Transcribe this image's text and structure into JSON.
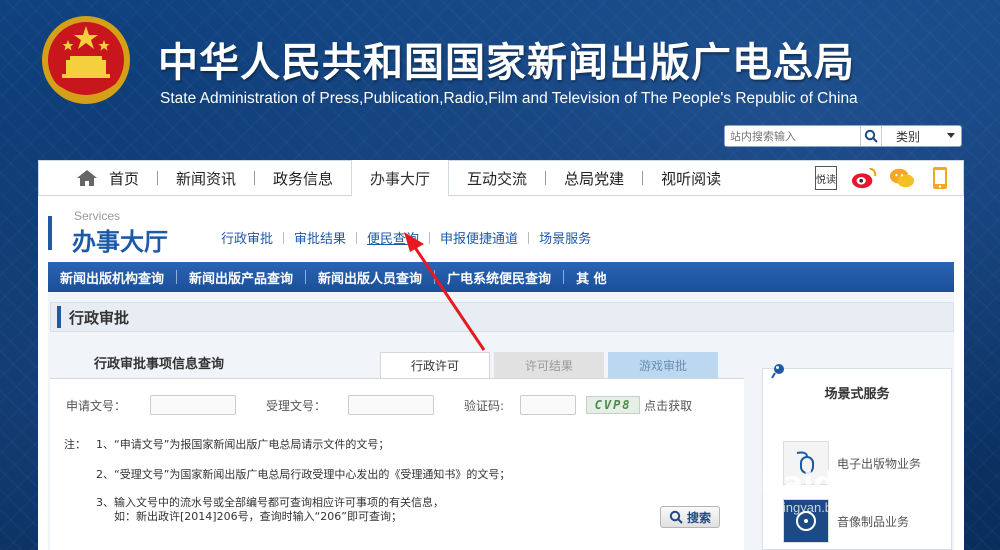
{
  "header": {
    "title": "中华人民共和国国家新闻出版广电总局",
    "subtitle": "State Administration of Press,Publication,Radio,Film and Television of The People's Republic of China",
    "search_placeholder": "站内搜索输入",
    "search_category": "类别"
  },
  "topnav": {
    "items": [
      "首页",
      "新闻资讯",
      "政务信息",
      "办事大厅",
      "互动交流",
      "总局党建",
      "视听阅读"
    ],
    "active": "办事大厅",
    "social_labels": [
      "悦读"
    ]
  },
  "section": {
    "en": "Services",
    "cn": "办事大厅",
    "links": [
      "行政审批",
      "审批结果",
      "便民查询",
      "申报便捷通道",
      "场景服务"
    ]
  },
  "bluebar": {
    "items": [
      "新闻出版机构查询",
      "新闻出版产品查询",
      "新闻出版人员查询",
      "广电系统便民查询",
      "其 他"
    ]
  },
  "subsection": {
    "title": "行政审批"
  },
  "query": {
    "title": "行政审批事项信息查询",
    "tabs": [
      "行政许可",
      "许可结果",
      "游戏审批"
    ],
    "form": {
      "apply_no_label": "申请文号：",
      "accept_no_label": "受理文号：",
      "captcha_label": "验证码:",
      "captcha_value": "CVP8",
      "captcha_refresh": "点击获取"
    },
    "notes": {
      "prefix": "注：",
      "n1": "1、“申请文号”为报国家新闻出版广电总局请示文件的文号；",
      "n2": "2、“受理文号”为国家新闻出版广电总局行政受理中心发出的《受理通知书》的文号；",
      "n3": "3、输入文号中的流水号或全部编号都可查询相应许可事项的有关信息，",
      "n3b": "如：新出政许[2014]206号，查询时输入“206”即可查询；"
    },
    "search_label": "搜索"
  },
  "scene": {
    "title": "场景式服务",
    "items": [
      "电子出版物业务",
      "音像制品业务"
    ]
  },
  "watermark": {
    "main": "Baidu 经验",
    "sub": "jingyan.baidu.com"
  }
}
